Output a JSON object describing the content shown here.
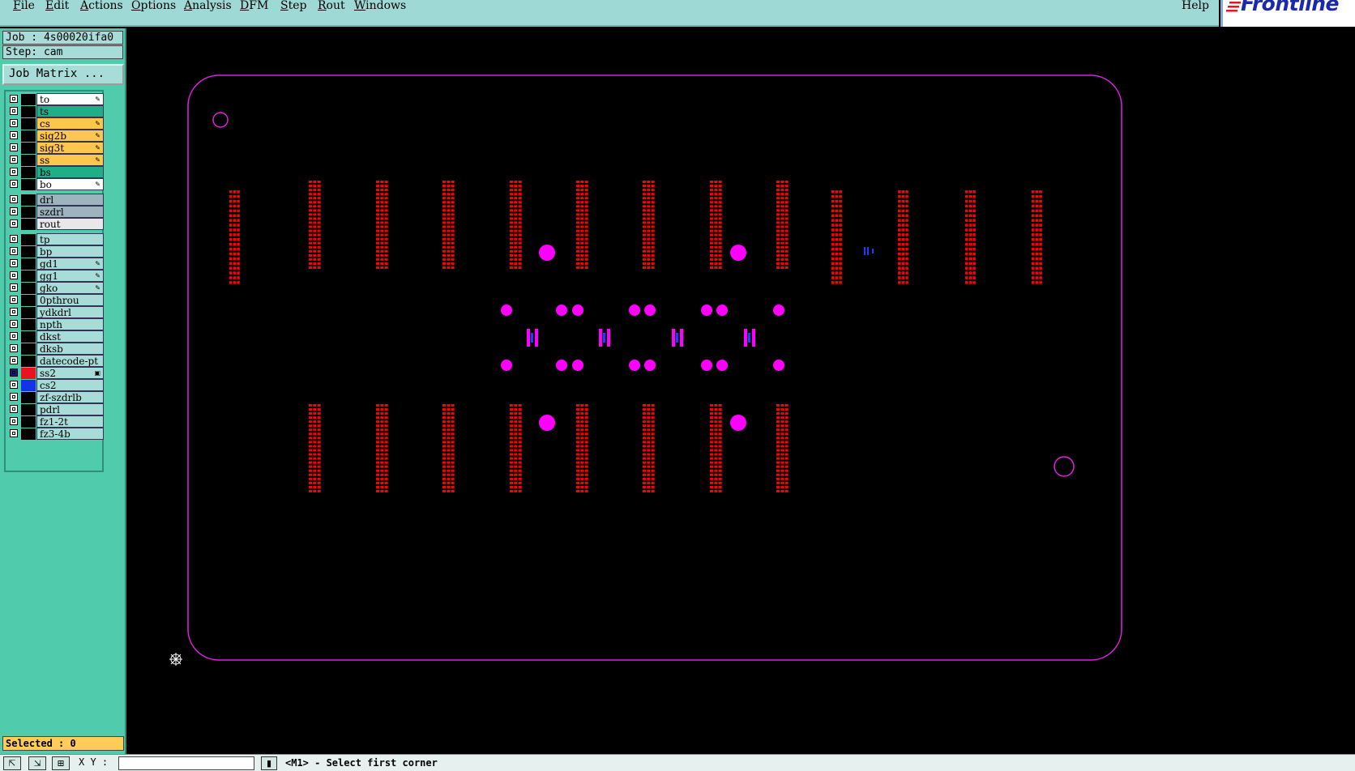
{
  "menu": {
    "items": [
      "File",
      "Edit",
      "Actions",
      "Options",
      "Analysis",
      "DFM",
      "Step",
      "Rout",
      "Windows"
    ],
    "help": "Help"
  },
  "logo": {
    "text": "Frontline"
  },
  "info": {
    "job": "Job : 4s00020ifa0",
    "step": "Step: cam",
    "job_matrix": "Job Matrix ..."
  },
  "layers": [
    {
      "name": "to",
      "color": "#ffffff",
      "flag": "pencil"
    },
    {
      "name": "ts",
      "color": "#1fae86",
      "flag": ""
    },
    {
      "name": "cs",
      "color": "#ffc64f",
      "flag": "pencil"
    },
    {
      "name": "sig2b",
      "color": "#ffc64f",
      "flag": "pencil"
    },
    {
      "name": "sig3t",
      "color": "#ffc64f",
      "flag": "pencil"
    },
    {
      "name": "ss",
      "color": "#ffc64f",
      "flag": "pencil"
    },
    {
      "name": "bs",
      "color": "#1fae86",
      "flag": ""
    },
    {
      "name": "bo",
      "color": "#ffffff",
      "flag": "pencil"
    },
    {
      "name": "drl",
      "color": "#9db3bd",
      "flag": ""
    },
    {
      "name": "szdrl",
      "color": "#9db3bd",
      "flag": ""
    },
    {
      "name": "rout",
      "color": "#e8e8e8",
      "flag": ""
    },
    {
      "name": "tp",
      "color": "#a8dcd8",
      "flag": ""
    },
    {
      "name": "bp",
      "color": "#a8dcd8",
      "flag": ""
    },
    {
      "name": "gd1",
      "color": "#a8dcd8",
      "flag": "pencil"
    },
    {
      "name": "gg1",
      "color": "#a8dcd8",
      "flag": "pencil"
    },
    {
      "name": "gko",
      "color": "#a8dcd8",
      "flag": "pencil"
    },
    {
      "name": "0pthrou",
      "color": "#a8dcd8",
      "flag": ""
    },
    {
      "name": "ydkdrl",
      "color": "#a8dcd8",
      "flag": ""
    },
    {
      "name": "npth",
      "color": "#a8dcd8",
      "flag": ""
    },
    {
      "name": "dkst",
      "color": "#a8dcd8",
      "flag": ""
    },
    {
      "name": "dksb",
      "color": "#a8dcd8",
      "flag": ""
    },
    {
      "name": "datecode-pt",
      "color": "#a8dcd8",
      "flag": ""
    },
    {
      "name": "ss2",
      "color": "#a8dcd8",
      "flag": "box",
      "swatch": "#e8141e",
      "active": true
    },
    {
      "name": "cs2",
      "color": "#a8dcd8",
      "flag": "",
      "swatch": "#1432e8"
    },
    {
      "name": "zf-szdrlb",
      "color": "#a8dcd8",
      "flag": ""
    },
    {
      "name": "pdrl",
      "color": "#a8dcd8",
      "flag": ""
    },
    {
      "name": "fz1-2t",
      "color": "#a8dcd8",
      "flag": ""
    },
    {
      "name": "fz3-4b",
      "color": "#a8dcd8",
      "flag": ""
    }
  ],
  "status": {
    "selected": "Selected : 0"
  },
  "bottom": {
    "xy_label": "X Y :",
    "xy_value": "",
    "prompt": "<M1> - Select first corner"
  },
  "colors": {
    "outline": "#e020e0",
    "pads": "#ff0000",
    "vias": "#ff00ff",
    "blue_features": "#1e3cff",
    "background": "#000000"
  }
}
